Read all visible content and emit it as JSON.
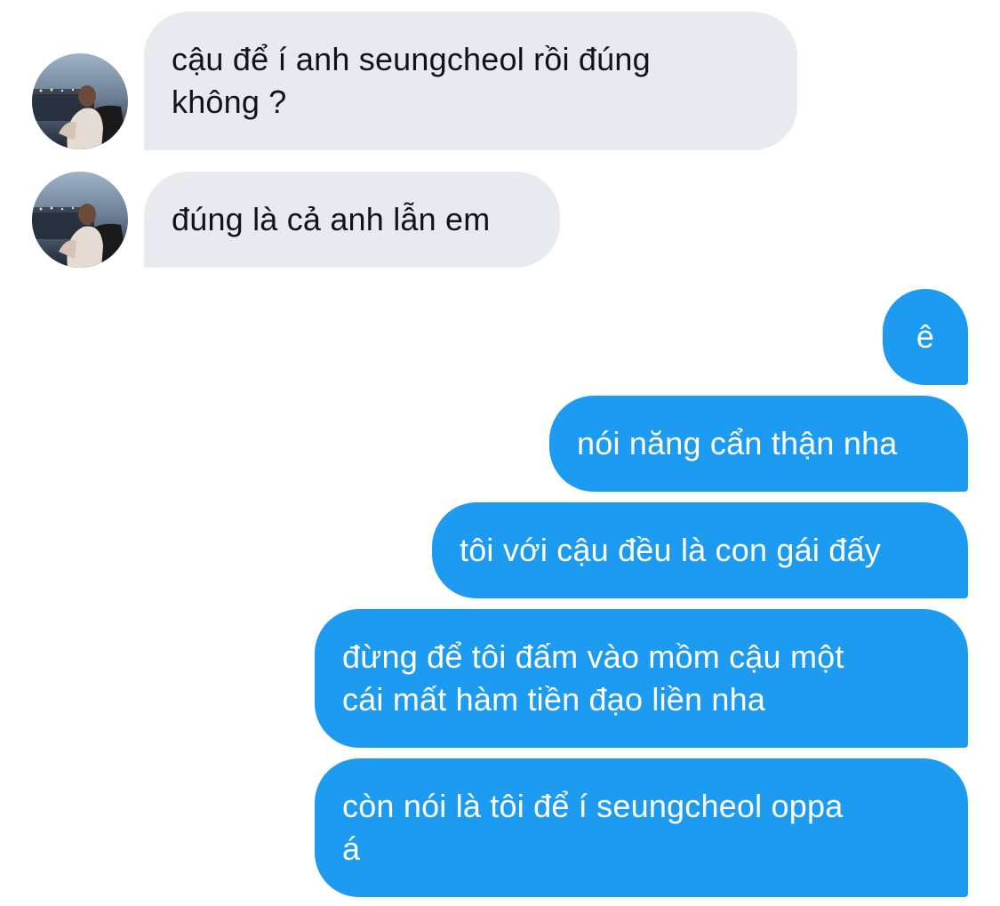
{
  "conversation": {
    "messages": [
      {
        "sender": "other",
        "text": "cậu để í anh seungcheol rồi đúng\nkhông ?"
      },
      {
        "sender": "other",
        "text": "đúng là cả anh lẫn em"
      },
      {
        "sender": "me",
        "text": "ê"
      },
      {
        "sender": "me",
        "text": "nói năng cẩn thận nha"
      },
      {
        "sender": "me",
        "text": "tôi với cậu đều là con gái đấy"
      },
      {
        "sender": "me",
        "text": "đừng để tôi đấm vào mồm cậu một\ncái mất hàm tiền đạo liền nha"
      },
      {
        "sender": "me",
        "text": "còn nói là tôi để í seungcheol oppa\ná"
      }
    ]
  },
  "colors": {
    "incoming_bubble": "#e7ebef",
    "outgoing_bubble": "#1d9bf0",
    "incoming_text": "#0f1419",
    "outgoing_text": "#ffffff",
    "background": "#ffffff"
  },
  "icons": {
    "avatar": "contact-avatar-photo"
  }
}
